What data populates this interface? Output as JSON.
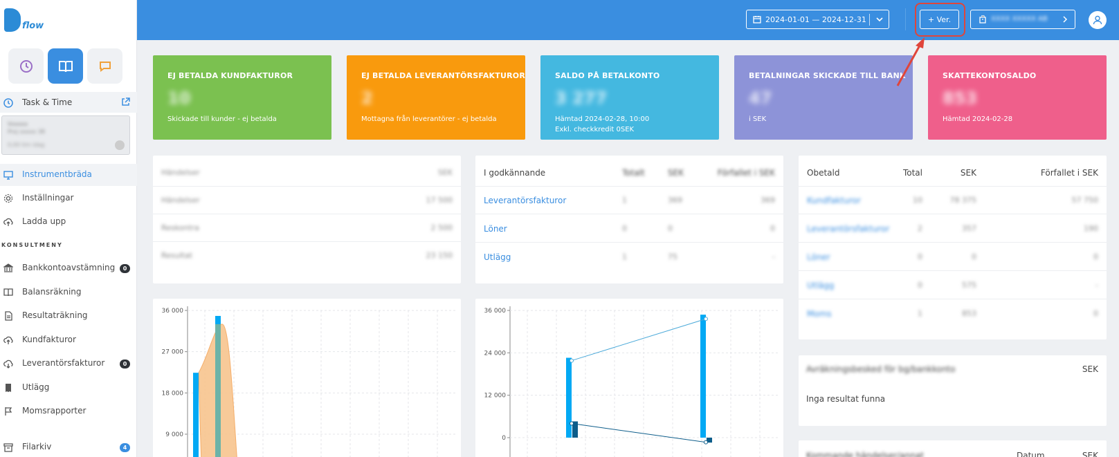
{
  "brand": {
    "logo_text": "flow",
    "accent": "#3a8ee0"
  },
  "sidebar": {
    "task_time": {
      "label": "Task & Time",
      "card_line1": "Vxxxxx",
      "card_line2": "Proj xxxxx 38",
      "card_line3": "0,00 tim idag"
    },
    "nav": [
      {
        "label": "Instrumentbräda",
        "icon": "monitor-icon",
        "active": true
      },
      {
        "label": "Inställningar",
        "icon": "gear-icon"
      },
      {
        "label": "Ladda upp",
        "icon": "cloud-upload-icon"
      }
    ],
    "section_label": "KONSULTMENY",
    "consult": [
      {
        "label": "Bankkontoavstämning",
        "icon": "bank-icon",
        "badge": "0"
      },
      {
        "label": "Balansräkning",
        "icon": "book-icon"
      },
      {
        "label": "Resultaträkning",
        "icon": "document-icon"
      },
      {
        "label": "Kundfakturor",
        "icon": "cloud-upload-icon"
      },
      {
        "label": "Leverantörsfakturor",
        "icon": "cloud-download-icon",
        "badge": "0"
      },
      {
        "label": "Utlägg",
        "icon": "receipt-icon"
      },
      {
        "label": "Momsrapporter",
        "icon": "flag-icon"
      }
    ],
    "archive": {
      "label": "Filarkiv",
      "icon": "archive-icon",
      "badge": "4"
    }
  },
  "topbar": {
    "date_range": "2024-01-01 — 2024-12-31",
    "ver_label": "+ Ver.",
    "company": "XXXX XXXXX AB"
  },
  "kpis": [
    {
      "title": "EJ BETALDA KUNDFAKTUROR",
      "value": "10",
      "sub": "Skickade till kunder - ej betalda",
      "sub2": "",
      "color": "#7bc150"
    },
    {
      "title": "EJ BETALDA LEVERANTÖRSFAKTUROR",
      "value": "2",
      "sub": "Mottagna från leverantörer - ej betalda",
      "sub2": "",
      "color": "#f99a0d"
    },
    {
      "title": "SALDO PÅ BETALKONTO",
      "value": "3 277",
      "sub": "Hämtad 2024-02-28, 10:00",
      "sub2": "Exkl. checkkredit 0SEK",
      "color": "#44b8e0"
    },
    {
      "title": "BETALNINGAR SKICKADE TILL BANK",
      "value": "47",
      "sub": "i SEK",
      "sub2": "",
      "color": "#8d93d8"
    },
    {
      "title": "SKATTEKONTOSALDO",
      "value": "853",
      "sub": "Hämtad 2024-02-28",
      "sub2": "",
      "color": "#ef5f8b"
    }
  ],
  "summary_card": {
    "rows": [
      [
        "Händelser",
        "SEK"
      ],
      [
        "Händelser",
        "17 500"
      ],
      [
        "Reskontra",
        "2 500"
      ],
      [
        "Resultat",
        "23 150"
      ]
    ]
  },
  "approval": {
    "headers": [
      "I godkännande",
      "Totalt",
      "SEK",
      "Förfallet i SEK"
    ],
    "rows": [
      [
        "Leverantörsfakturor",
        "1",
        "369",
        "369"
      ],
      [
        "Löner",
        "0",
        "0",
        "0"
      ],
      [
        "Utlägg",
        "1",
        "75",
        "-"
      ]
    ]
  },
  "unpaid": {
    "headers": [
      "Obetald",
      "Total",
      "SEK",
      "Förfallet i SEK"
    ],
    "rows": [
      [
        "Kundfakturor",
        "10",
        "78 375",
        "57 750"
      ],
      [
        "Leverantörsfakturor",
        "2",
        "357",
        "190"
      ],
      [
        "Löner",
        "0",
        "0",
        "0"
      ],
      [
        "Utlägg",
        "0",
        "575",
        "-"
      ],
      [
        "Moms",
        "1",
        "853",
        "0"
      ]
    ]
  },
  "agreements": {
    "title": "Avräkningsbesked för bg/bankkonto",
    "col": "SEK",
    "empty": "Inga resultat funna"
  },
  "upcoming": {
    "title": "Kommande händelser/annat",
    "col1": "Datum",
    "col2": "SEK"
  },
  "chart_data": [
    {
      "type": "bar",
      "ylim": [
        0,
        36000
      ],
      "yticks": [
        "36 000",
        "27 000",
        "18 000",
        "9 000"
      ],
      "series": [
        {
          "values": [
            22400,
            34800
          ]
        },
        {
          "values": [
            33000
          ]
        }
      ]
    },
    {
      "type": "bar",
      "ylim": [
        0,
        36000
      ],
      "yticks": [
        "36 000",
        "24 000",
        "12 000",
        "0"
      ],
      "series": [
        {
          "values": [
            22600,
            34800
          ]
        },
        {
          "values": [
            4600,
            -1400
          ]
        }
      ],
      "lines": [
        {
          "values": [
            21800,
            33600
          ]
        },
        {
          "values": [
            4000,
            -1300
          ]
        }
      ]
    }
  ]
}
